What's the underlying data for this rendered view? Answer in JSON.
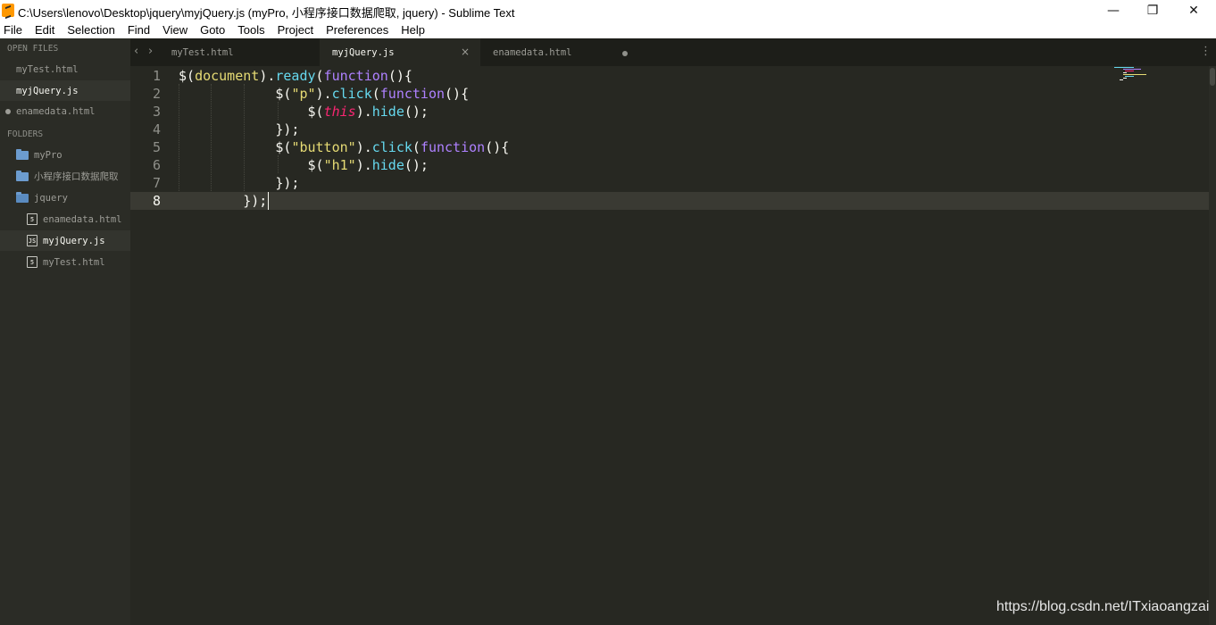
{
  "window": {
    "title": "C:\\Users\\lenovo\\Desktop\\jquery\\myjQuery.js (myPro, 小程序接口数据爬取, jquery) - Sublime Text",
    "minimize_glyph": "—",
    "maximize_glyph": "❐",
    "close_glyph": "✕"
  },
  "menu": [
    "File",
    "Edit",
    "Selection",
    "Find",
    "View",
    "Goto",
    "Tools",
    "Project",
    "Preferences",
    "Help"
  ],
  "sidebar": {
    "open_files_heading": "OPEN FILES",
    "open_files": [
      {
        "label": "myTest.html",
        "active": false,
        "modified": false
      },
      {
        "label": "myjQuery.js",
        "active": true,
        "modified": false
      },
      {
        "label": "enamedata.html",
        "active": false,
        "modified": true
      }
    ],
    "folders_heading": "FOLDERS",
    "folders": [
      {
        "label": "myPro",
        "icon": "folder-icon"
      },
      {
        "label": "小程序接口数据爬取",
        "icon": "folder-icon"
      },
      {
        "label": "jquery",
        "icon": "folder-open-icon"
      }
    ],
    "folder_files": [
      {
        "label": "enamedata.html",
        "icon": "html5-file-icon",
        "badge": "5",
        "active": false
      },
      {
        "label": "myjQuery.js",
        "icon": "js-file-icon",
        "badge": "JS",
        "active": true
      },
      {
        "label": "myTest.html",
        "icon": "html5-file-icon",
        "badge": "5",
        "active": false
      }
    ]
  },
  "tabs": {
    "back_glyph": "‹",
    "forward_glyph": "›",
    "items": [
      {
        "label": "myTest.html",
        "active": false
      },
      {
        "label": "myjQuery.js",
        "active": true,
        "close_glyph": "×"
      },
      {
        "label": "enamedata.html",
        "active": false,
        "modified": true
      }
    ],
    "menu_glyph": "⋮"
  },
  "editor": {
    "line_numbers": [
      "1",
      "2",
      "3",
      "4",
      "5",
      "6",
      "7",
      "8"
    ],
    "current_line": "8",
    "lines": [
      [
        {
          "t": "$(",
          "c": "punc"
        },
        {
          "t": "document",
          "c": "str"
        },
        {
          "t": ").",
          "c": "punc"
        },
        {
          "t": "ready",
          "c": "fn"
        },
        {
          "t": "(",
          "c": "punc"
        },
        {
          "t": "function",
          "c": "kw"
        },
        {
          "t": "(){",
          "c": "punc"
        }
      ],
      [
        {
          "t": "            $(",
          "c": "punc"
        },
        {
          "t": "\"p\"",
          "c": "str"
        },
        {
          "t": ").",
          "c": "punc"
        },
        {
          "t": "click",
          "c": "fn"
        },
        {
          "t": "(",
          "c": "punc"
        },
        {
          "t": "function",
          "c": "kw"
        },
        {
          "t": "(){",
          "c": "punc"
        }
      ],
      [
        {
          "t": "                $(",
          "c": "punc"
        },
        {
          "t": "this",
          "c": "this"
        },
        {
          "t": ").",
          "c": "punc"
        },
        {
          "t": "hide",
          "c": "fn"
        },
        {
          "t": "();",
          "c": "punc"
        }
      ],
      [
        {
          "t": "            });",
          "c": "punc"
        }
      ],
      [
        {
          "t": "            $(",
          "c": "punc"
        },
        {
          "t": "\"button\"",
          "c": "str"
        },
        {
          "t": ").",
          "c": "punc"
        },
        {
          "t": "click",
          "c": "fn"
        },
        {
          "t": "(",
          "c": "punc"
        },
        {
          "t": "function",
          "c": "kw"
        },
        {
          "t": "(){",
          "c": "punc"
        }
      ],
      [
        {
          "t": "                $(",
          "c": "punc"
        },
        {
          "t": "\"h1\"",
          "c": "str"
        },
        {
          "t": ").",
          "c": "punc"
        },
        {
          "t": "hide",
          "c": "fn"
        },
        {
          "t": "();",
          "c": "punc"
        }
      ],
      [
        {
          "t": "            });",
          "c": "punc"
        }
      ],
      [
        {
          "t": "        });",
          "c": "punc"
        }
      ]
    ]
  },
  "colors": {
    "editor_bg": "#272822",
    "sidebar_bg": "#2b2c26",
    "keyword": "#ae81ff",
    "function": "#66d9ef",
    "string": "#e6db74",
    "this": "#f92672"
  },
  "watermark": "https://blog.csdn.net/ITxiaoangzai"
}
